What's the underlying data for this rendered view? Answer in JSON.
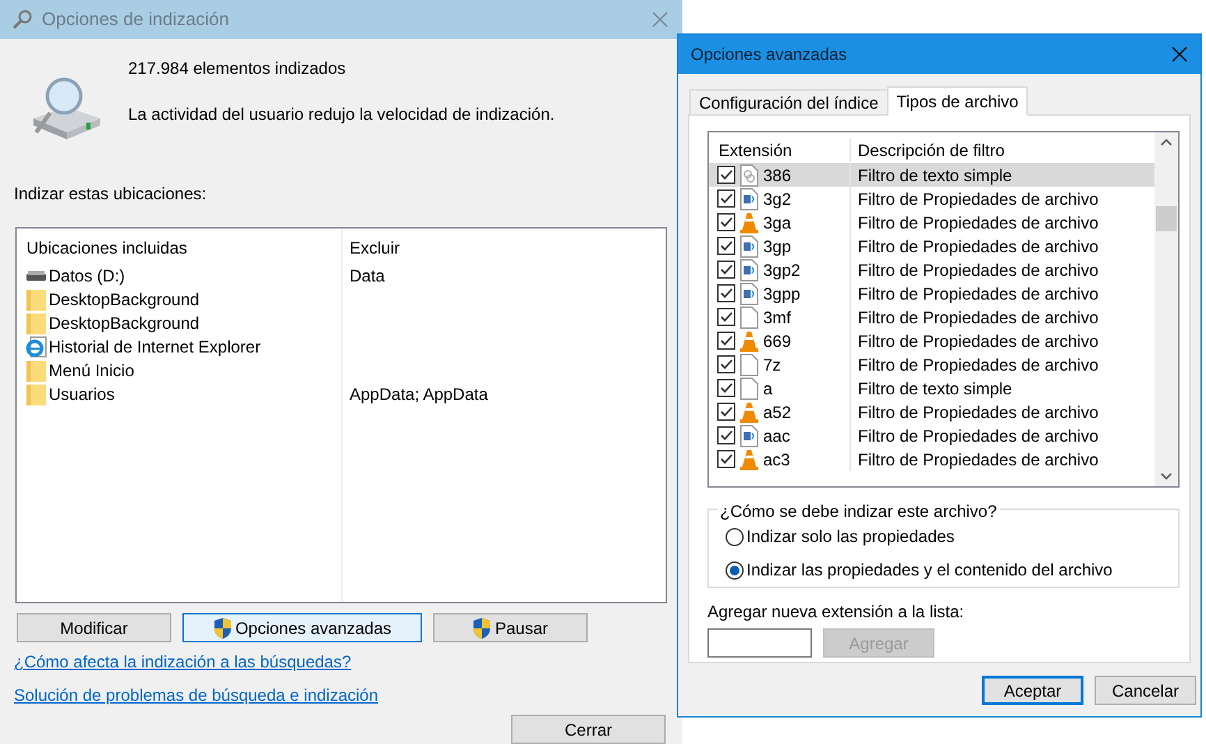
{
  "main_window": {
    "title": "Opciones de indización",
    "status": [
      "217.984 elementos indizados",
      "La actividad del usuario redujo la velocidad de indización."
    ],
    "locations_label": "Indizar estas ubicaciones:",
    "columns": [
      "Ubicaciones incluidas",
      "Excluir"
    ],
    "locations": [
      {
        "kind": "drive",
        "name": "Datos (D:)",
        "exclude": "Data"
      },
      {
        "kind": "folder",
        "name": "DesktopBackground"
      },
      {
        "kind": "folder",
        "name": "DesktopBackground"
      },
      {
        "kind": "ie",
        "name": "Historial de Internet Explorer"
      },
      {
        "kind": "folder",
        "name": "Menú Inicio"
      },
      {
        "kind": "folder",
        "name": "Usuarios",
        "exclude": "AppData; AppData"
      }
    ],
    "buttons": [
      {
        "label": "Modificar",
        "shield": false,
        "focused": false
      },
      {
        "label": "Opciones avanzadas",
        "shield": true,
        "focused": true
      },
      {
        "label": "Pausar",
        "shield": true,
        "focused": false
      }
    ],
    "links": [
      "¿Cómo afecta la indización a las búsquedas?",
      "Solución de problemas de búsqueda e indización"
    ],
    "close_button": "Cerrar"
  },
  "advanced_dialog": {
    "title": "Opciones avanzadas",
    "tabs": [
      {
        "label": "Configuración del índice",
        "selected": false
      },
      {
        "label": "Tipos de archivo",
        "selected": true
      }
    ],
    "columns": [
      "Extensión",
      "Descripción de filtro"
    ],
    "file_types": [
      {
        "kind": "text",
        "ext": "386",
        "filter": "Filtro de texto simple",
        "checked": true,
        "selected": true
      },
      {
        "kind": "media",
        "ext": "3g2",
        "filter": "Filtro de Propiedades de archivo",
        "checked": true,
        "selected": false
      },
      {
        "kind": "cone",
        "ext": "3ga",
        "filter": "Filtro de Propiedades de archivo",
        "checked": true,
        "selected": false
      },
      {
        "kind": "media",
        "ext": "3gp",
        "filter": "Filtro de Propiedades de archivo",
        "checked": true,
        "selected": false
      },
      {
        "kind": "media",
        "ext": "3gp2",
        "filter": "Filtro de Propiedades de archivo",
        "checked": true,
        "selected": false
      },
      {
        "kind": "media",
        "ext": "3gpp",
        "filter": "Filtro de Propiedades de archivo",
        "checked": true,
        "selected": false
      },
      {
        "kind": "blank",
        "ext": "3mf",
        "filter": "Filtro de Propiedades de archivo",
        "checked": true,
        "selected": false
      },
      {
        "kind": "cone",
        "ext": "669",
        "filter": "Filtro de Propiedades de archivo",
        "checked": true,
        "selected": false
      },
      {
        "kind": "blank",
        "ext": "7z",
        "filter": "Filtro de Propiedades de archivo",
        "checked": true,
        "selected": false
      },
      {
        "kind": "blank",
        "ext": "a",
        "filter": "Filtro de texto simple",
        "checked": true,
        "selected": false
      },
      {
        "kind": "cone",
        "ext": "a52",
        "filter": "Filtro de Propiedades de archivo",
        "checked": true,
        "selected": false
      },
      {
        "kind": "media",
        "ext": "aac",
        "filter": "Filtro de Propiedades de archivo",
        "checked": true,
        "selected": false
      },
      {
        "kind": "cone",
        "ext": "ac3",
        "filter": "Filtro de Propiedades de archivo",
        "checked": true,
        "selected": false
      }
    ],
    "index_group": {
      "legend": "¿Cómo se debe indizar este archivo?",
      "options": [
        {
          "label": "Indizar solo las propiedades",
          "selected": false
        },
        {
          "label": "Indizar las propiedades y el contenido del archivo",
          "selected": true
        }
      ]
    },
    "add_label": "Agregar nueva extensión a la lista:",
    "add_button": {
      "label": "Agregar",
      "disabled": true
    },
    "buttons": [
      {
        "label": "Aceptar",
        "focused": true
      },
      {
        "label": "Cancelar",
        "focused": false
      }
    ]
  }
}
